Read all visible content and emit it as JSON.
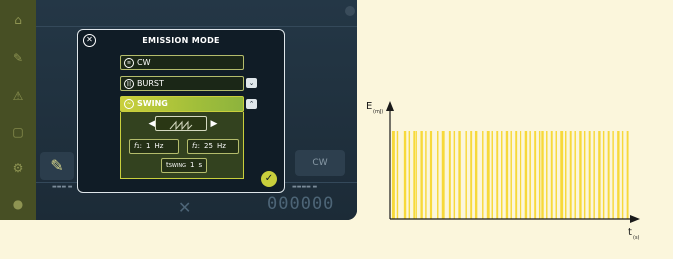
{
  "modal": {
    "title": "EMISSION MODE",
    "close_icon": "close-icon",
    "options": [
      {
        "label": "CW",
        "icon": "cw-icon",
        "selected": false,
        "has_chevron": false
      },
      {
        "label": "BURST",
        "icon": "burst-icon",
        "selected": false,
        "has_chevron": true,
        "chevron": "chevron-down-icon"
      },
      {
        "label": "SWING",
        "icon": "swing-icon",
        "selected": true,
        "has_chevron": true,
        "chevron": "chevron-up-icon"
      }
    ],
    "swing": {
      "waveform_icon": "sawtooth-wave-icon",
      "f1": {
        "label": "f",
        "sub": "1",
        "value": "1",
        "unit": "Hz"
      },
      "f2": {
        "label": "f",
        "sub": "2",
        "value": "25",
        "unit": "Hz"
      },
      "t_sweep": {
        "label": "t",
        "sub": "SWING",
        "value": "1",
        "unit": "s"
      }
    },
    "confirm_icon": "check-icon"
  },
  "background": {
    "mode_label": "CW",
    "counter": "000000"
  },
  "colors": {
    "accent": "#c9cf3c",
    "modal_bg": "#101c26",
    "chart_bar": "#f7d93a"
  },
  "chart": {
    "ylabel": "E",
    "ylabel_sub": "(mJ)",
    "xlabel": "t",
    "xlabel_sub": "(s)"
  },
  "chart_data": {
    "type": "bar",
    "ylabel": "E(mJ)",
    "xlabel": "t(s)",
    "pulse_times": [
      0.0,
      0.02,
      0.05,
      0.07,
      0.09,
      0.1,
      0.12,
      0.14,
      0.16,
      0.19,
      0.21,
      0.24,
      0.26,
      0.28,
      0.31,
      0.33,
      0.35,
      0.38,
      0.4,
      0.42,
      0.44,
      0.46,
      0.48,
      0.5,
      0.52,
      0.54,
      0.56,
      0.58,
      0.6,
      0.62,
      0.63,
      0.65,
      0.67,
      0.69,
      0.71,
      0.73,
      0.75,
      0.77,
      0.79,
      0.81,
      0.83,
      0.85,
      0.87,
      0.89,
      0.91,
      0.93,
      0.95,
      0.97,
      0.99
    ],
    "pulse_widths": [
      0.012,
      0.006,
      0.01,
      0.006,
      0.008,
      0.005,
      0.01,
      0.006,
      0.009,
      0.006,
      0.012,
      0.008,
      0.006,
      0.01,
      0.006,
      0.008,
      0.01,
      0.006,
      0.012,
      0.006,
      0.008,
      0.006,
      0.01,
      0.006,
      0.008,
      0.005,
      0.01,
      0.006,
      0.008,
      0.006,
      0.01,
      0.006,
      0.008,
      0.006,
      0.012,
      0.006,
      0.008,
      0.006,
      0.01,
      0.006,
      0.008,
      0.006,
      0.01,
      0.006,
      0.008,
      0.006,
      0.01,
      0.006,
      0.008
    ],
    "energy": 1
  }
}
